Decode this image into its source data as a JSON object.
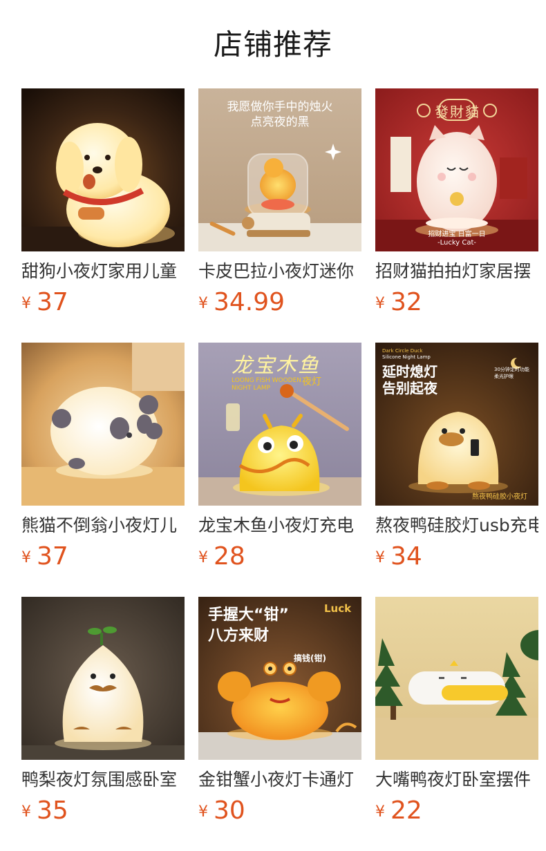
{
  "page": {
    "title": "店铺推荐"
  },
  "products": [
    {
      "name": "甜狗小夜灯家用儿童",
      "currency": "¥",
      "price": "37",
      "image_texts": []
    },
    {
      "name": "卡皮巴拉小夜灯迷你",
      "currency": "¥",
      "price": "34.99",
      "image_texts": [
        "我愿做你手中的烛火",
        "点亮夜的黑"
      ]
    },
    {
      "name": "招财猫拍拍灯家居摆",
      "currency": "¥",
      "price": "32",
      "image_texts": [
        "發",
        "財",
        "貓",
        "招财进宝 日富一日",
        "-Lucky Cat-"
      ]
    },
    {
      "name": "熊猫不倒翁小夜灯儿",
      "currency": "¥",
      "price": "37",
      "image_texts": []
    },
    {
      "name": "龙宝木鱼小夜灯充电",
      "currency": "¥",
      "price": "28",
      "image_texts": [
        "龙宝木鱼",
        "LOONG FISH WOODEN",
        "NIGHT LAMP",
        "夜灯"
      ]
    },
    {
      "name": "熬夜鸭硅胶灯usb充电",
      "currency": "¥",
      "price": "34",
      "image_texts": [
        "Dark Circle Duck",
        "Silicone Night Lamp",
        "延时熄灯",
        "告别起夜",
        "30分钟定时功能",
        "柔光护眼",
        "熬夜鸭硅胶小夜灯"
      ]
    },
    {
      "name": "鸭梨夜灯氛围感卧室",
      "currency": "¥",
      "price": "35",
      "image_texts": []
    },
    {
      "name": "金钳蟹小夜灯卡通灯",
      "currency": "¥",
      "price": "30",
      "image_texts": [
        "手握大“钳”",
        "八方来财",
        "Luck",
        "搞钱(钳)"
      ]
    },
    {
      "name": "大嘴鸭夜灯卧室摆件",
      "currency": "¥",
      "price": "22",
      "image_texts": []
    }
  ]
}
